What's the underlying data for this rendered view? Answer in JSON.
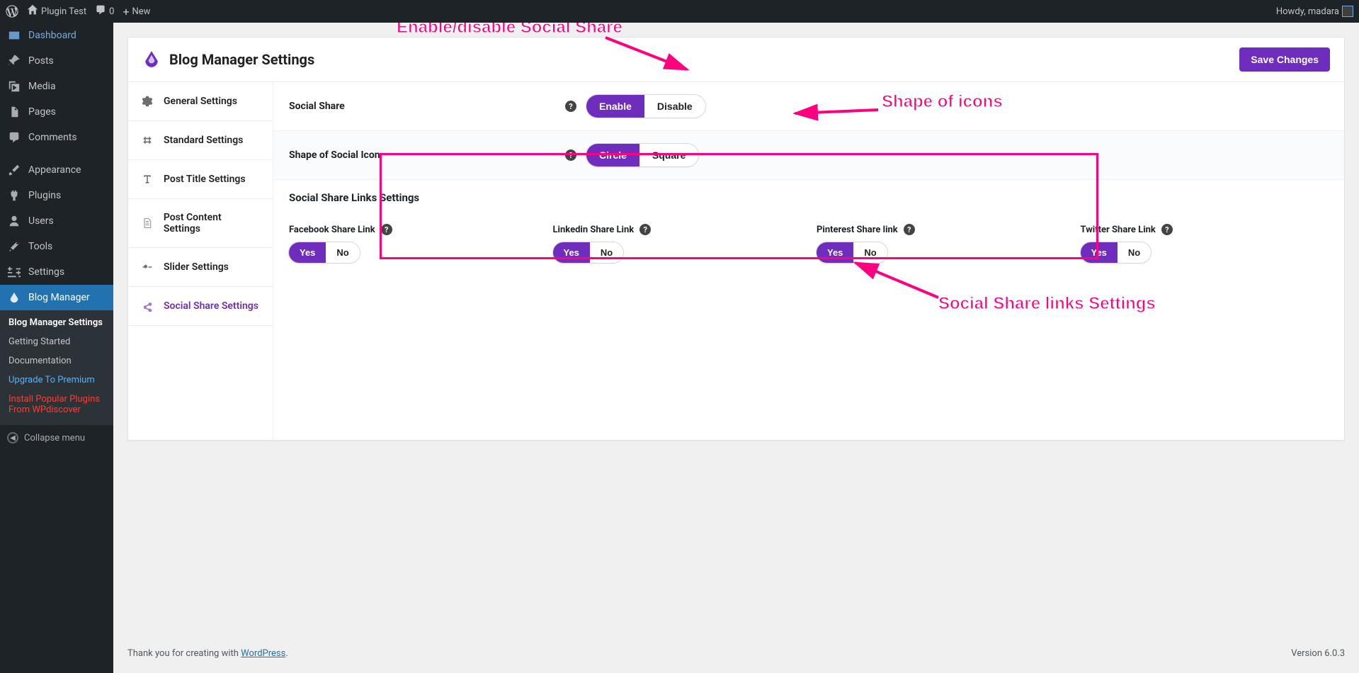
{
  "adminbar": {
    "site_title": "Plugin Test",
    "comments_count": "0",
    "new_label": "New",
    "howdy": "Howdy, madara"
  },
  "adminmenu": {
    "dashboard": "Dashboard",
    "posts": "Posts",
    "media": "Media",
    "pages": "Pages",
    "comments": "Comments",
    "appearance": "Appearance",
    "plugins": "Plugins",
    "users": "Users",
    "tools": "Tools",
    "settings": "Settings",
    "blog_manager": "Blog Manager",
    "submenu": {
      "settings": "Blog Manager Settings",
      "getting_started": "Getting Started",
      "documentation": "Documentation",
      "upgrade": "Upgrade To Premium",
      "install_popular": "Install Popular Plugins From WPdiscover"
    },
    "collapse": "Collapse menu"
  },
  "page": {
    "title": "Blog Manager Settings",
    "save": "Save Changes"
  },
  "tabs": {
    "general": "General Settings",
    "standard": "Standard Settings",
    "post_title": "Post Title Settings",
    "post_content": "Post Content Settings",
    "slider": "Slider Settings",
    "social": "Social Share Settings"
  },
  "settings": {
    "social_share_label": "Social Share",
    "social_share": {
      "on": "Enable",
      "off": "Disable"
    },
    "shape_label": "Shape of Social Icon",
    "shape": {
      "on": "Circle",
      "off": "Square"
    },
    "links_heading": "Social Share Links Settings",
    "facebook_label": "Facebook Share Link",
    "linkedin_label": "Linkedin Share Link",
    "pinterest_label": "Pinterest Share link",
    "twitter_label": "Twitter Share Link",
    "yes": "Yes",
    "no": "No"
  },
  "annotations": {
    "enable": "Enable/disable Social Share",
    "shape": "Shape of icons",
    "links": "Social Share links Settings"
  },
  "footer": {
    "thank_pre": "Thank you for creating with ",
    "wp": "WordPress",
    "thank_post": ".",
    "version": "Version 6.0.3"
  }
}
